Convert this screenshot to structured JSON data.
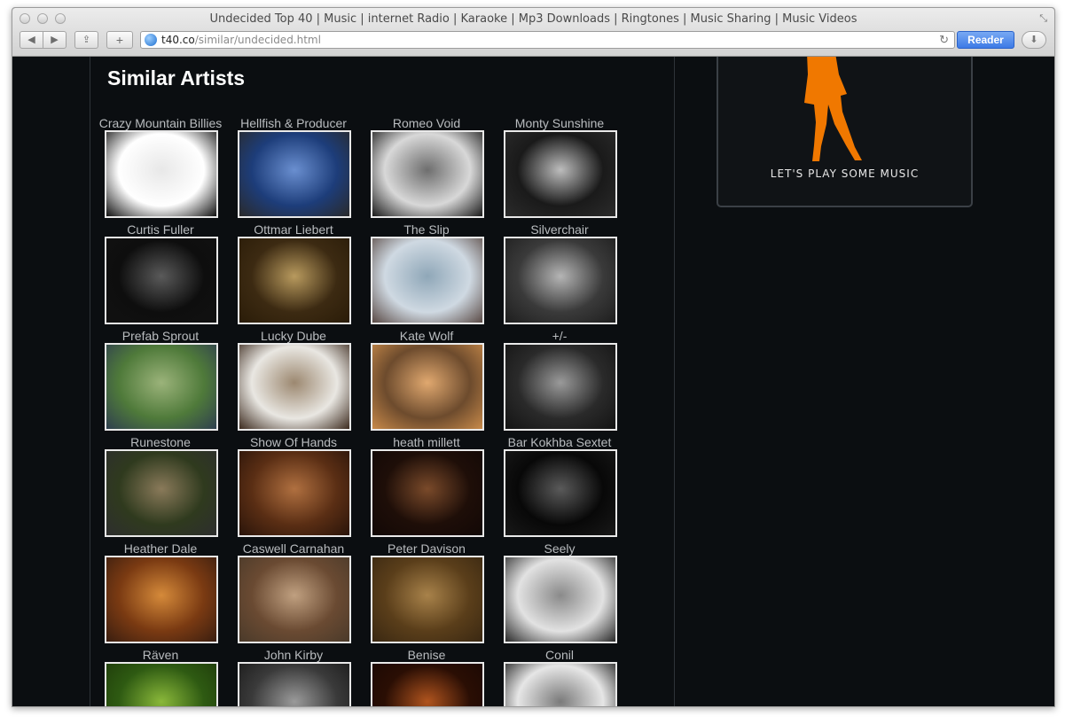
{
  "browser": {
    "window_title": "Undecided Top 40 | Music | internet Radio | Karaoke | Mp3 Downloads | Ringtones | Music Sharing | Music Videos",
    "url_host": "t40.co",
    "url_path": "/similar/undecided.html",
    "reader_label": "Reader",
    "back_icon": "◀",
    "forward_icon": "▶",
    "share_icon": "⇪",
    "add_icon": "+",
    "reload_icon": "↻",
    "download_icon": "⬇",
    "resize_icon": "⤡"
  },
  "page": {
    "heading": "Similar Artists",
    "promo_text": "LET'S PLAY SOME MUSIC",
    "accent_color": "#f07800"
  },
  "artists": [
    {
      "name": "Crazy Mountain Billies",
      "c1": "#ffffff",
      "c2": "#e8e8e8",
      "c3": "#111111"
    },
    {
      "name": "Hellfish & Producer",
      "c1": "#1d3d7a",
      "c2": "#6a8fd0",
      "c3": "#2a2a2a"
    },
    {
      "name": "Romeo Void",
      "c1": "#d8d8d8",
      "c2": "#6e6e6e",
      "c3": "#1a1a1a"
    },
    {
      "name": "Monty Sunshine",
      "c1": "#1a1a1a",
      "c2": "#bdbdbd",
      "c3": "#2b2b2b"
    },
    {
      "name": "Curtis Fuller",
      "c1": "#0e0e0e",
      "c2": "#5a5a5a",
      "c3": "#111111"
    },
    {
      "name": "Ottmar Liebert",
      "c1": "#3c2a12",
      "c2": "#b89a5e",
      "c3": "#2a1c08"
    },
    {
      "name": "The Slip",
      "c1": "#cfd9e2",
      "c2": "#8fa7b8",
      "c3": "#5a4a45"
    },
    {
      "name": "Silverchair",
      "c1": "#3a3a3a",
      "c2": "#b5b5b5",
      "c3": "#1e1e1e"
    },
    {
      "name": "Prefab Sprout",
      "c1": "#4f7a3a",
      "c2": "#9bb37a",
      "c3": "#2f3f4f"
    },
    {
      "name": "Lucky Dube",
      "c1": "#e9e7e2",
      "c2": "#9c8870",
      "c3": "#3c2a1e"
    },
    {
      "name": "Kate Wolf",
      "c1": "#6d4b2d",
      "c2": "#e0a86f",
      "c3": "#c88a4a"
    },
    {
      "name": "+/-",
      "c1": "#2a2a2a",
      "c2": "#9a9a9a",
      "c3": "#141414"
    },
    {
      "name": "Runestone",
      "c1": "#2f3a1e",
      "c2": "#8a7a5a",
      "c3": "#2e2e2e"
    },
    {
      "name": "Show Of Hands",
      "c1": "#5a2e14",
      "c2": "#b07040",
      "c3": "#2a140a"
    },
    {
      "name": "heath millett",
      "c1": "#1e0e08",
      "c2": "#7a4a2a",
      "c3": "#120806"
    },
    {
      "name": "Bar Kokhba Sextet",
      "c1": "#080808",
      "c2": "#5a5a5a",
      "c3": "#181818"
    },
    {
      "name": "Heather Dale",
      "c1": "#7a3a12",
      "c2": "#d58a3a",
      "c3": "#3a1e10"
    },
    {
      "name": "Caswell Carnahan",
      "c1": "#6a4a32",
      "c2": "#c0a080",
      "c3": "#4a3a2a"
    },
    {
      "name": "Peter Davison",
      "c1": "#5a3e1a",
      "c2": "#a8824a",
      "c3": "#3a2812"
    },
    {
      "name": "Seely",
      "c1": "#e2e2e2",
      "c2": "#8a8a8a",
      "c3": "#2a2a2a"
    },
    {
      "name": "Räven",
      "c1": "#2e5a12",
      "c2": "#8ab83a",
      "c3": "#1e3a0a"
    },
    {
      "name": "John Kirby",
      "c1": "#3a3a3a",
      "c2": "#9a9a9a",
      "c3": "#1a1a1a"
    },
    {
      "name": "Benise",
      "c1": "#2a0e04",
      "c2": "#b0541e",
      "c3": "#1a0804"
    },
    {
      "name": "Conil",
      "c1": "#e6e6e6",
      "c2": "#7a7a7a",
      "c3": "#1a1a1a"
    }
  ]
}
